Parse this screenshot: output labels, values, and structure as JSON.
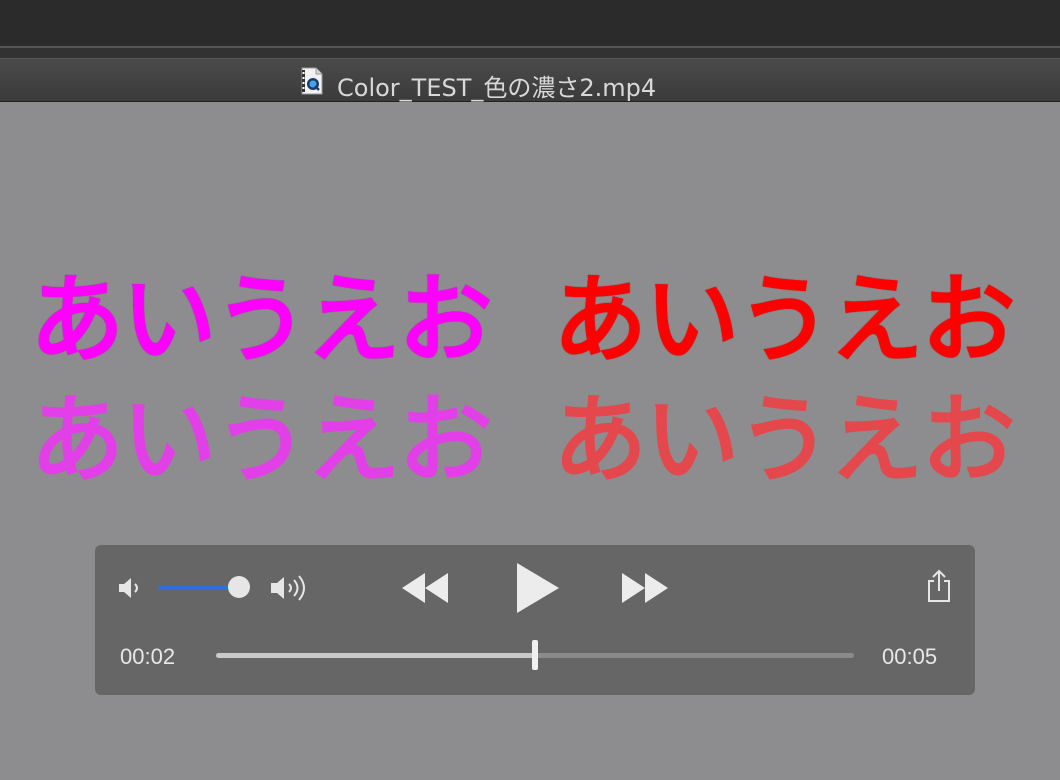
{
  "window": {
    "title": "Color_TEST_色の濃さ2.mp4",
    "file_icon": "quicktime-movie-file-icon"
  },
  "video": {
    "text_rows": [
      {
        "text": "あいうえお",
        "color": "#ff00ff"
      },
      {
        "text": "あいうえお",
        "color": "#ff0000"
      },
      {
        "text": "あいうえお",
        "color": "#e23fe8"
      },
      {
        "text": "あいうえお",
        "color": "#e4474c"
      }
    ],
    "background": "#8d8c8e"
  },
  "controls": {
    "current_time": "00:02",
    "duration": "00:05",
    "progress": 0.5,
    "volume": 0.9,
    "icons": {
      "volume_low": "speaker-low-icon",
      "volume_high": "speaker-high-icon",
      "rewind": "rewind-icon",
      "play": "play-icon",
      "fast_forward": "fast-forward-icon",
      "share": "share-icon"
    },
    "volume_color": "#2f6fdb"
  }
}
